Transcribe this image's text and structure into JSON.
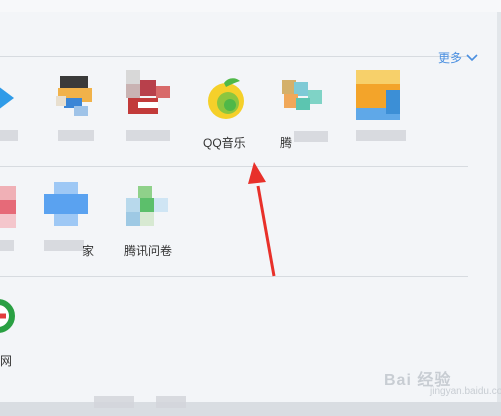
{
  "header": {
    "more_label": "更多"
  },
  "apps": {
    "row1": [
      {
        "name": "QQ音乐",
        "label": "QQ音乐"
      },
      {
        "name": "tencent-partial",
        "label": "腾"
      }
    ],
    "row2": [
      {
        "name": "partial-home",
        "label": "家"
      },
      {
        "name": "tencent-survey",
        "label": "腾讯问卷"
      }
    ],
    "row3": [
      {
        "name": "partial-web",
        "label": "网"
      }
    ]
  },
  "watermark": {
    "main": "Bai 经验",
    "sub": "jingyan.baidu.com"
  },
  "colors": {
    "accent": "#4a8fe0",
    "arrow": "#e8302a",
    "qqmusic_yellow": "#f5d02a",
    "qqmusic_green": "#4fb848"
  }
}
